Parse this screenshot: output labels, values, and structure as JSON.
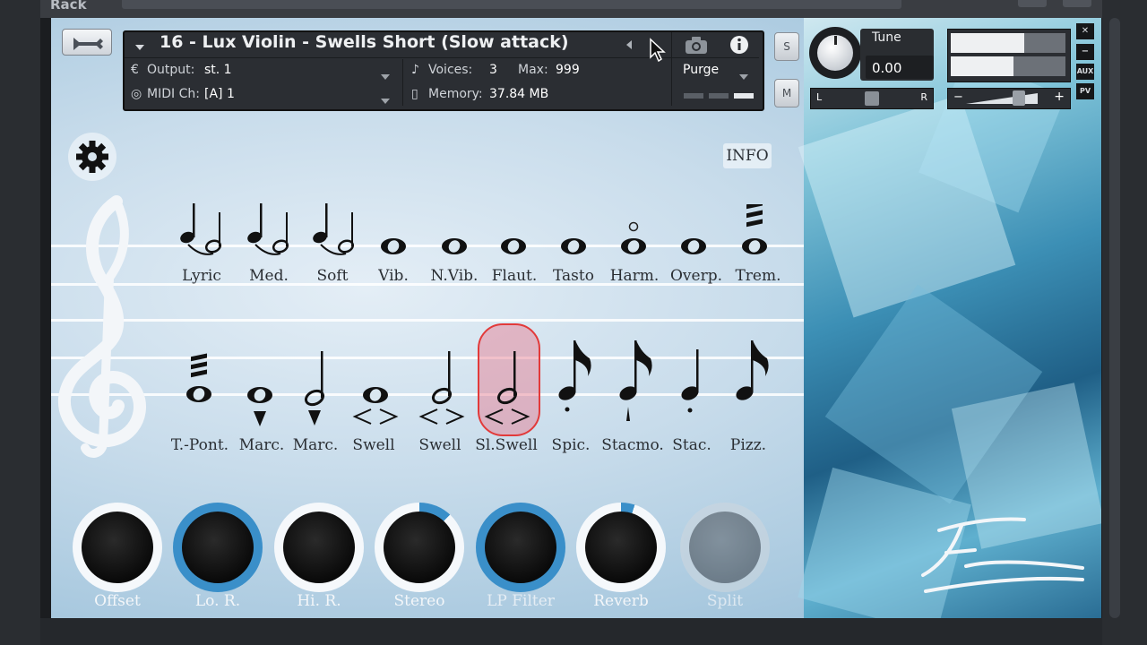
{
  "rack": {
    "label": "Rack"
  },
  "header": {
    "title": "16 - Lux Violin - Swells Short (Slow attack)",
    "output_label": "Output:",
    "output_value": "st. 1",
    "midi_label": "MIDI Ch:",
    "midi_value": "[A]  1",
    "voices_label": "Voices:",
    "voices_value": "3",
    "max_label": "Max:",
    "max_value": "999",
    "memory_label": "Memory:",
    "memory_value": "37.84 MB",
    "purge_label": "Purge",
    "s_label": "S",
    "m_label": "M"
  },
  "side": {
    "tune_label": "Tune",
    "tune_value": "0.00",
    "pan_left": "L",
    "pan_right": "R",
    "vol_minus": "−",
    "vol_plus": "+",
    "close": "✕",
    "minimize": "−",
    "aux": "AUX",
    "pv": "PV"
  },
  "info_label": "INFO",
  "articulations_row1": [
    "Lyric",
    "Med.",
    "Soft",
    "Vib.",
    "N.Vib.",
    "Flaut.",
    "Tasto",
    "Harm.",
    "Overp.",
    "Trem."
  ],
  "articulations_row2": [
    "T.-Pont.",
    "Marc.",
    "Marc.",
    "Swell",
    "Swell",
    "Sl.Swell",
    "Spic.",
    "Stacmo.",
    "Stac.",
    "Pizz."
  ],
  "selected_articulation": "Sl.Swell",
  "knobs": [
    {
      "label": "Offset",
      "level": 0.0
    },
    {
      "label": "Lo. R.",
      "level": 1.0
    },
    {
      "label": "Hi. R.",
      "level": 0.0
    },
    {
      "label": "Stereo",
      "level": 0.12
    },
    {
      "label": "LP Filter",
      "level": 1.0
    },
    {
      "label": "Reverb",
      "level": 0.05
    },
    {
      "label": "Split",
      "level": 0.0
    }
  ],
  "colors": {
    "accent": "#3a8fc9",
    "selection": "#e23a3a",
    "header_bg": "#2b2e33"
  }
}
